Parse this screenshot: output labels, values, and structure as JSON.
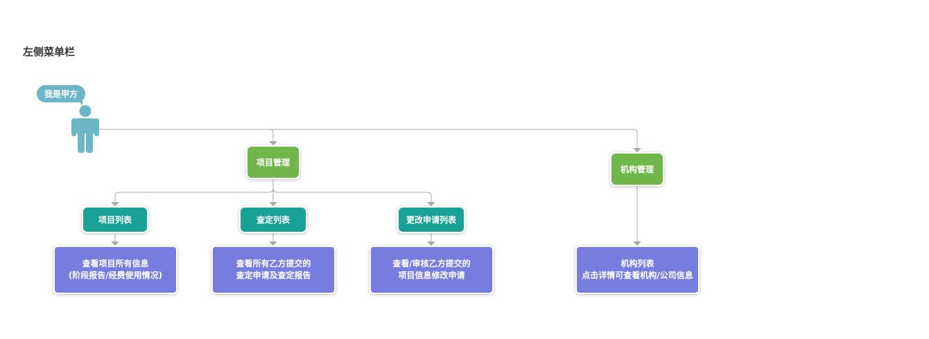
{
  "page": {
    "title": "左侧菜单栏"
  },
  "actor": {
    "label": "我是甲方"
  },
  "colors": {
    "actor": "#6bb7c8",
    "level1": "#71b64a",
    "level2": "#1aa196",
    "level3": "#777dde",
    "connector": "#a8a8a8"
  },
  "nodes": {
    "project_mgmt": "项目管理",
    "org_mgmt": "机构管理",
    "project_list": "项目列表",
    "review_list": "查定列表",
    "change_list": "更改申请列表",
    "project_list_desc": {
      "line1": "查看项目所有信息",
      "line2": "(阶段报告/经费使用情况)"
    },
    "review_list_desc": {
      "line1": "查看所有乙方提交的",
      "line2": "查定申请及查定报告"
    },
    "change_list_desc": {
      "line1": "查看/审核乙方提交的",
      "line2": "项目信息修改申请"
    },
    "org_list_desc": {
      "line1": "机构列表",
      "line2": "点击详情可查看机构/公司信息"
    }
  }
}
